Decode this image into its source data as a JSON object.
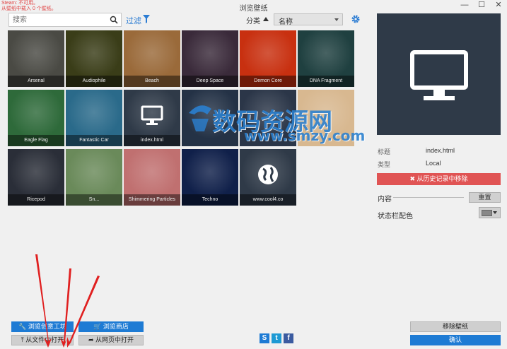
{
  "window": {
    "title": "浏览壁纸",
    "status_lines": [
      "Steam: 不可用。",
      "从壁纸中载入 0 个壁纸。"
    ],
    "controls": [
      "—",
      "☐",
      "✕"
    ]
  },
  "toolbar": {
    "search_placeholder": "搜索",
    "filter_label": "过滤",
    "sort_label": "分类",
    "sort_value": "名称"
  },
  "wallpapers": [
    {
      "name": "Arsenal",
      "color": "#4a4a44"
    },
    {
      "name": "Audiophile",
      "color": "#3a3d18"
    },
    {
      "name": "Beach",
      "color": "#9a6a3a"
    },
    {
      "name": "Deep Space",
      "color": "#3a2a3a"
    },
    {
      "name": "Demon Core",
      "color": "#c83010"
    },
    {
      "name": "DNA Fragment",
      "color": "#1f4040"
    },
    {
      "name": "Eagle Flag",
      "color": "#2e6a3a"
    },
    {
      "name": "Fantastic Car",
      "color": "#2a6a8a"
    },
    {
      "name": "index.html",
      "color": "#2f3a48"
    },
    {
      "name": "",
      "color": "#243246"
    },
    {
      "name": "",
      "color": "#2b3648"
    },
    {
      "name": "",
      "color": "#d8b890"
    },
    {
      "name": "Ricepod",
      "color": "#2a2e38"
    },
    {
      "name": "Sn...",
      "color": "#6a8a5a"
    },
    {
      "name": "Shimmering Particles",
      "color": "#c07070"
    },
    {
      "name": "Techno",
      "color": "#10204a"
    },
    {
      "name": "www.cool4.co",
      "color": "#2f3a48"
    }
  ],
  "watermark": {
    "line1": "数码资源网",
    "line2": "www.smzy.com"
  },
  "details": {
    "title_label": "标题",
    "title_value": "index.html",
    "type_label": "类型",
    "type_value": "Local",
    "remove_history": "✖ 从历史记录中移除",
    "content_label": "内容",
    "reset_label": "重置",
    "statusbar_color_label": "状态栏配色",
    "statusbar_color": "#888888"
  },
  "bottom": {
    "browse_workshop": "🔧 浏览创意工坊",
    "browse_store": "🛒 浏览商店",
    "open_from_file": "⤒ 从文件中打开",
    "open_from_web": "➦ 从网页中打开",
    "remove_wallpaper": "移除壁纸",
    "confirm": "确认"
  },
  "colors": {
    "accent": "#1e7bd4",
    "danger": "#e05454"
  }
}
